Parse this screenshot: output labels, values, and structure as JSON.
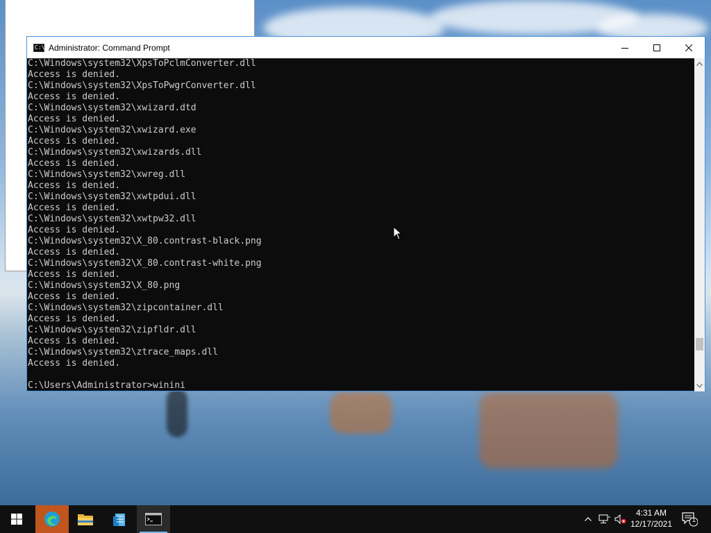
{
  "window": {
    "title": "Administrator: Command Prompt",
    "icon": "console-icon"
  },
  "console": {
    "lines": [
      "C:\\Windows\\system32\\XpsToPclmConverter.dll",
      "Access is denied.",
      "C:\\Windows\\system32\\XpsToPwgrConverter.dll",
      "Access is denied.",
      "C:\\Windows\\system32\\xwizard.dtd",
      "Access is denied.",
      "C:\\Windows\\system32\\xwizard.exe",
      "Access is denied.",
      "C:\\Windows\\system32\\xwizards.dll",
      "Access is denied.",
      "C:\\Windows\\system32\\xwreg.dll",
      "Access is denied.",
      "C:\\Windows\\system32\\xwtpdui.dll",
      "Access is denied.",
      "C:\\Windows\\system32\\xwtpw32.dll",
      "Access is denied.",
      "C:\\Windows\\system32\\X_80.contrast-black.png",
      "Access is denied.",
      "C:\\Windows\\system32\\X_80.contrast-white.png",
      "Access is denied.",
      "C:\\Windows\\system32\\X_80.png",
      "Access is denied.",
      "C:\\Windows\\system32\\zipcontainer.dll",
      "Access is denied.",
      "C:\\Windows\\system32\\zipfldr.dll",
      "Access is denied.",
      "C:\\Windows\\system32\\ztrace_maps.dll",
      "Access is denied.",
      "",
      "C:\\Users\\Administrator>winini"
    ]
  },
  "taskbar": {
    "items": [
      {
        "name": "start-button",
        "icon": "windows-logo-icon"
      },
      {
        "name": "taskbar-edge",
        "icon": "edge-icon"
      },
      {
        "name": "taskbar-file-explorer",
        "icon": "folder-icon"
      },
      {
        "name": "taskbar-server-manager",
        "icon": "server-manager-icon"
      },
      {
        "name": "taskbar-command-prompt",
        "icon": "console-icon"
      }
    ],
    "clock": {
      "time": "4:31 AM",
      "date": "12/17/2021"
    },
    "notifications": {
      "count": "1"
    }
  },
  "colors": {
    "console_bg": "#0c0c0c",
    "console_fg": "#cccccc",
    "taskbar_bg": "#101010",
    "accent": "#76b9ed",
    "edge_highlight": "#c0551e"
  }
}
